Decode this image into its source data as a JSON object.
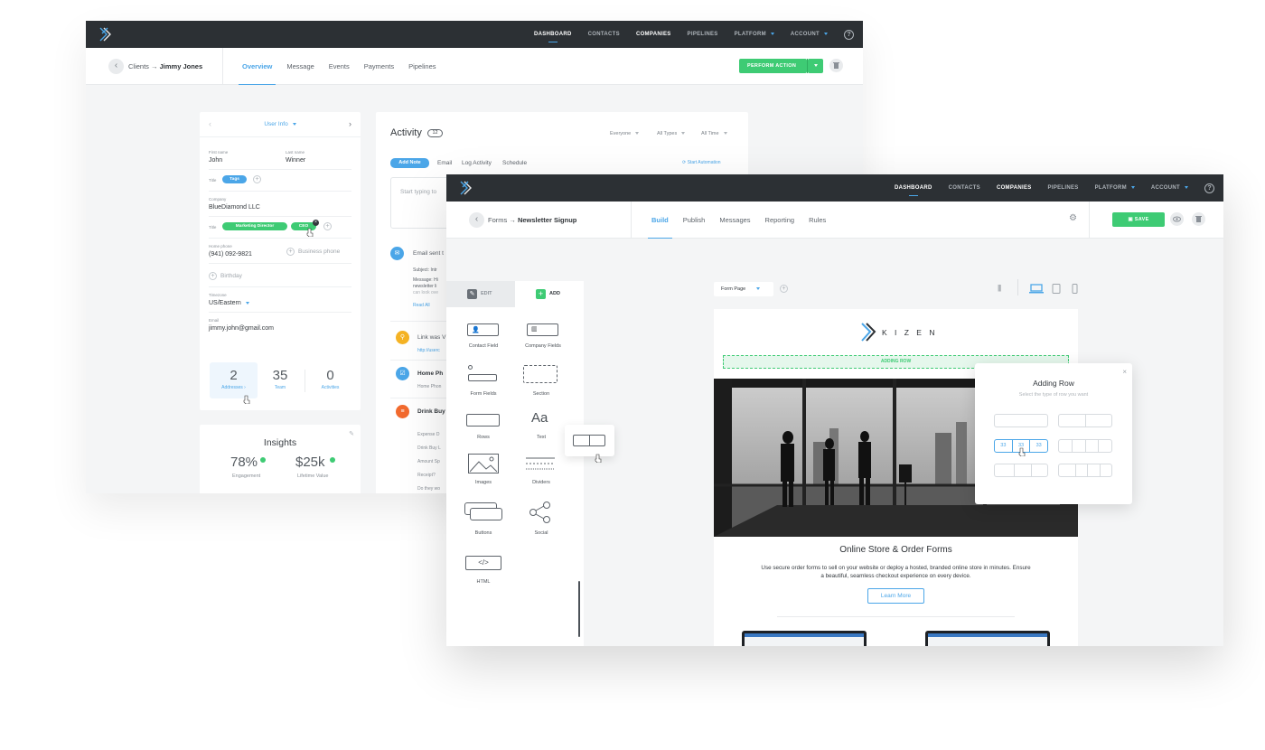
{
  "nav": {
    "items": [
      "DASHBOARD",
      "CONTACTS",
      "COMPANIES",
      "PIPELINES",
      "PLATFORM",
      "ACCOUNT"
    ],
    "help": "?"
  },
  "crm": {
    "breadcrumb": {
      "parent": "Clients",
      "arrow": "→",
      "current": "Jimmy Jones"
    },
    "tabs": [
      "Overview",
      "Message",
      "Events",
      "Payments",
      "Pipelines"
    ],
    "perform_action": "PERFORM ACTION",
    "user_info": {
      "title": "User Info",
      "first_name_label": "First name",
      "first_name": "John",
      "last_name_label": "Last name",
      "last_name": "Winner",
      "title_label": "Title",
      "tags_pill": "Tags",
      "company_label": "Company",
      "company": "BlueDiamond LLC",
      "title2_label": "Title",
      "title_pill_1": "Marketing Director",
      "title_pill_2": "CEO",
      "home_phone_label": "Home phone",
      "home_phone": "(941) 092-9821",
      "business_phone": "Business phone",
      "birthday": "Birthday",
      "timezone_label": "Timezone",
      "timezone": "US/Eastern",
      "email_label": "Email",
      "email": "jimmy.john@gmail.com",
      "stats": [
        {
          "value": "2",
          "label": "Addresses"
        },
        {
          "value": "35",
          "label": "Team"
        },
        {
          "value": "0",
          "label": "Activities"
        }
      ]
    },
    "insights": {
      "title": "Insights",
      "engagement_value": "78%",
      "engagement_label": "Engagement",
      "lifetime_value": "$25k",
      "lifetime_label": "Lifetime Value"
    },
    "activity": {
      "title": "Activity",
      "count": "12",
      "filters": [
        "Everyone",
        "All Types",
        "All Time"
      ],
      "add_note": "Add Note",
      "actions": [
        "Email",
        "Log Activity",
        "Schedule"
      ],
      "automation": "Start Automation",
      "placeholder": "Start typing to",
      "items": [
        {
          "title": "Email sent t",
          "subject": "Subject: Intr",
          "message": "Message: Hi",
          "message2": "newsletter li",
          "message3": "can look ove",
          "link": "Read All"
        },
        {
          "title": "Link was V",
          "sub": "http://userc"
        },
        {
          "title": "Home Ph",
          "sub": "Home Phon"
        },
        {
          "title": "Drink Buy",
          "subs": [
            "Expense D",
            "Drink Buy L",
            "Amount Sp",
            "Receipt?",
            "Do they wo"
          ]
        }
      ]
    }
  },
  "forms": {
    "breadcrumb": {
      "parent": "Forms",
      "arrow": "→",
      "current": "Newsletter Signup"
    },
    "tabs": [
      "Build",
      "Publish",
      "Messages",
      "Reporting",
      "Rules"
    ],
    "save": "SAVE",
    "panel": {
      "edit": "EDIT",
      "add": "ADD",
      "tiles": [
        "Contact Field",
        "Company Fields",
        "Form Fields",
        "Section",
        "Rows",
        "Text",
        "Images",
        "Dividers",
        "Buttons",
        "Social",
        "HTML"
      ],
      "text_glyph": "Aa",
      "html_glyph": "</>"
    },
    "page_select": "Form Page",
    "canvas": {
      "brand": "K I Z E N",
      "adding_row_banner": "ADDING ROW",
      "heading": "Online Store & Order Forms",
      "body": "Use secure order forms to sell on your website or deploy a hosted, branded online store in minutes. Ensure a beautiful, seamless checkout experience on every device.",
      "cta": "Learn More"
    },
    "modal": {
      "title": "Adding Row",
      "subtitle": "Select the type of row you want",
      "selected_cols": [
        "33",
        "33",
        "33"
      ],
      "close": "×"
    }
  },
  "colors": {
    "accent": "#4ba6e8",
    "green": "#3ecb74",
    "nav": "#2c3034",
    "orange": "#f26a2e",
    "yellow": "#f5b324"
  }
}
